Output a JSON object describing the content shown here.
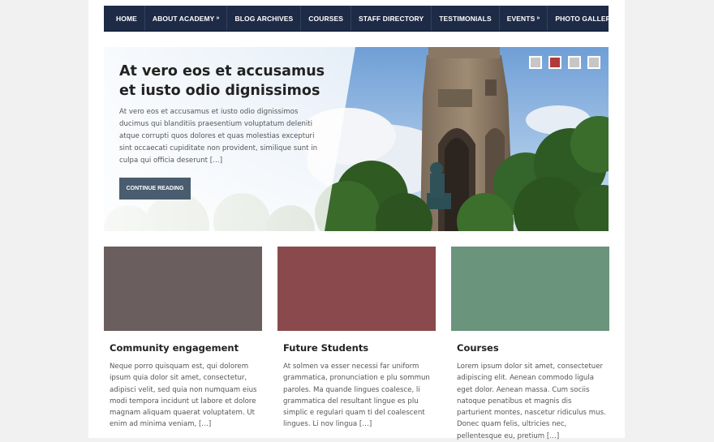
{
  "nav": {
    "items": [
      {
        "label": "HOME"
      },
      {
        "label": "ABOUT ACADEMY",
        "has_submenu": true
      },
      {
        "label": "BLOG ARCHIVES"
      },
      {
        "label": "COURSES"
      },
      {
        "label": "STAFF DIRECTORY"
      },
      {
        "label": "TESTIMONIALS"
      },
      {
        "label": "EVENTS",
        "has_submenu": true
      },
      {
        "label": "PHOTO GALLERY"
      }
    ],
    "submenu_marker": "»",
    "bg_color": "#1e2b47"
  },
  "slider": {
    "title": "At vero eos et accusamus et iusto odio dignissimos",
    "excerpt": "At vero eos et accusamus et iusto odio dignissimos ducimus qui blanditiis praesentium voluptatum deleniti atque corrupti quos dolores et quas molestias excepturi sint occaecati cupiditate non provident, similique sunt in culpa qui officia deserunt […]",
    "button_label": "CONTINUE READING",
    "dots": [
      false,
      true,
      false,
      false
    ],
    "active_dot_color": "#b23a3a"
  },
  "cards": [
    {
      "title": "Community engagement",
      "text": "Neque porro quisquam est, qui dolorem ipsum quia dolor sit amet, consectetur, adipisci velit, sed quia non numquam eius modi tempora incidunt ut labore et dolore magnam aliquam quaerat voluptatem. Ut enim ad minima veniam, […]",
      "color": "#6a5f5e"
    },
    {
      "title": "Future Students",
      "text": "At solmen va esser necessi far uniform grammatica, pronunciation e plu sommun paroles. Ma quande lingues coalesce, li grammatica del resultant lingue es plu simplic e regulari quam ti del coalescent lingues. Li nov lingua […]",
      "color": "#8a4a4d"
    },
    {
      "title": "Courses",
      "text": "Lorem ipsum dolor sit amet, consectetuer adipiscing elit. Aenean commodo ligula eget dolor. Aenean massa. Cum sociis natoque penatibus et magnis dis parturient montes, nascetur ridiculus mus. Donec quam felis, ultricies nec, pellentesque eu, pretium […]",
      "color": "#6a947c"
    }
  ]
}
